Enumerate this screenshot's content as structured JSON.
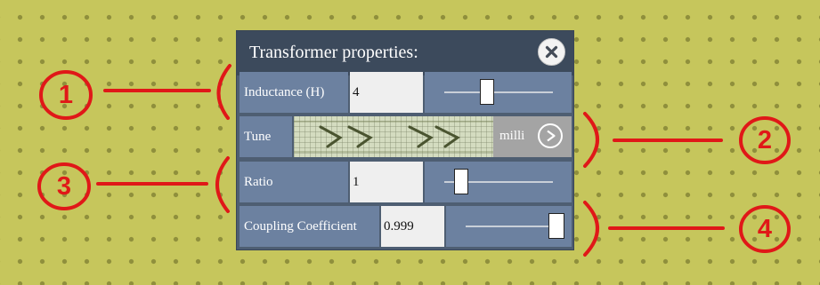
{
  "panel": {
    "title": "Transformer properties:",
    "close_icon": "close-icon"
  },
  "rows": {
    "inductance": {
      "label": "Inductance (H)",
      "value": "4",
      "slider_level": 0.52
    },
    "tune": {
      "label": "Tune",
      "unit": "milli",
      "play_icon": "play-icon"
    },
    "ratio": {
      "label": "Ratio",
      "value": "1",
      "slider_level": 0.3
    },
    "coupling": {
      "label": "Coupling Coefficient",
      "value": "0.999",
      "slider_level": 0.999
    }
  },
  "annotations": [
    "1",
    "2",
    "3",
    "4"
  ],
  "colors": {
    "annotation": "#e01818",
    "background": "#c6c65c",
    "header": "#3c4a5c",
    "row": "#6c81a0"
  }
}
